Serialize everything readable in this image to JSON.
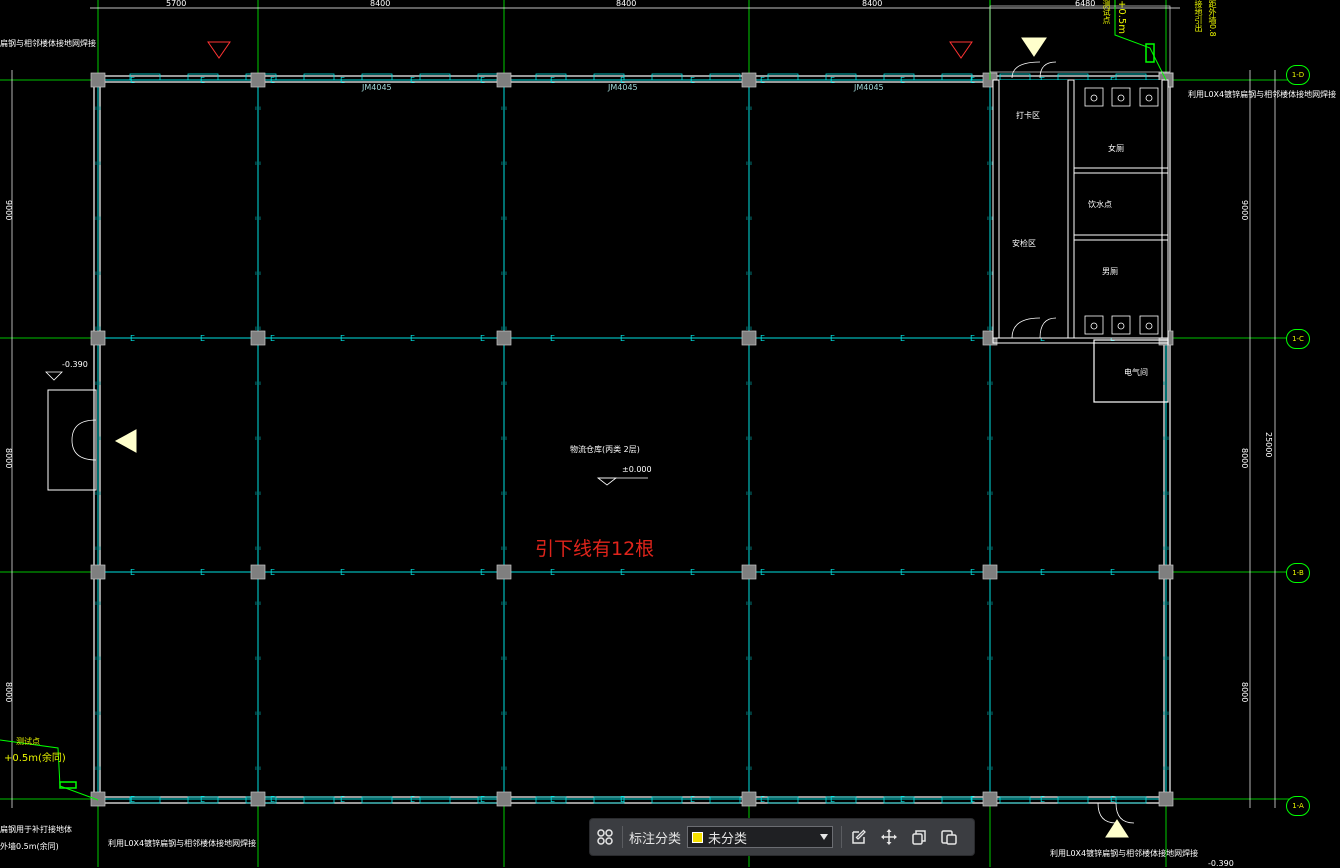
{
  "drawing": {
    "dims_top": [
      "5700",
      "8400",
      "8400",
      "8400",
      "6480"
    ],
    "dims_left": [
      "9000",
      "8000",
      "8000"
    ],
    "dims_right": [
      "9000",
      "8000",
      "8000"
    ],
    "dim_total_right": "25000",
    "grid_axes": [
      "1-D",
      "1-C",
      "1-B",
      "1-A"
    ],
    "window_tags": [
      "JM4045",
      "JM4045",
      "JM4045"
    ],
    "notes": {
      "top_left": "扁钢与相邻楼体接地网焊接",
      "top_right": "利用L0X4镀锌扁钢与相邻楼体接地网焊接",
      "bottom_left": "利用L0X4镀锌扁钢与相邻楼体接地网焊接",
      "bottom_right": "利用L0X4镀锌扁钢与相邻楼体接地网焊接",
      "left_mid_bottom": "扁钢用于补打接地体",
      "left_mid_bottom_2": "外墙0.5m(余同)",
      "test_point": "测试点",
      "test_height": "+0.5m(余同)",
      "elev_left": "-0.390",
      "top_vertical_1": "测试点",
      "top_vertical_2": "+0.5m",
      "top_vertical_3": "接地引出",
      "top_vertical_4": "距外墙0.8"
    },
    "rooms": {
      "room1": "打卡区",
      "room2": "女厕",
      "room3": "饮水点",
      "room4": "安检区",
      "room5": "男厕",
      "room6": "电气间"
    },
    "center_label": "物流仓库(丙类    2层)",
    "center_elev": "±0.000",
    "bottom_elev": "-0.390",
    "annotation": "引下线有12根"
  },
  "toolbar": {
    "category_label": "标注分类",
    "category_value": "未分类",
    "category_color": "#f5e000"
  },
  "colors": {
    "background": "#000000",
    "axis": "#00ff00",
    "wall": "#ffffff",
    "grid": "#00e0e0",
    "column": "#7f7f7f",
    "annotation": "#e0241b"
  }
}
